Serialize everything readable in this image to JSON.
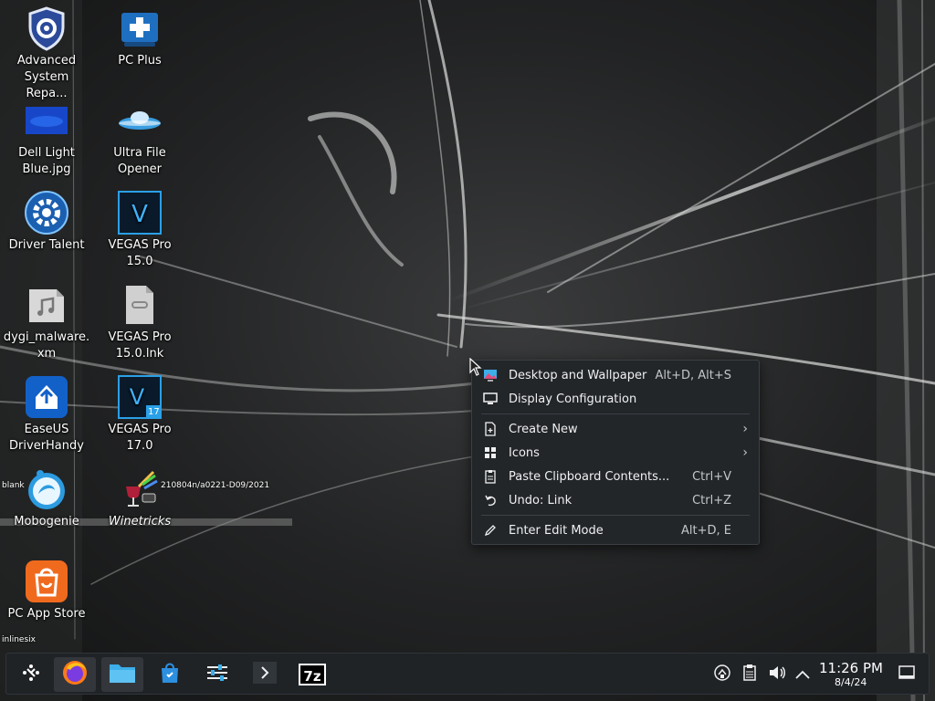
{
  "desktop": {
    "icons": [
      {
        "label": "Advanced System Repa...",
        "icon": "shield-gear-icon"
      },
      {
        "label": "PC Plus",
        "icon": "pc-plus-icon"
      },
      {
        "label": "Dell Light Blue.jpg",
        "icon": "image-file-icon"
      },
      {
        "label": "Ultra File Opener",
        "icon": "ufo-icon"
      },
      {
        "label": "Driver Talent",
        "icon": "gear-icon"
      },
      {
        "label": "VEGAS Pro 15.0",
        "icon": "vegas-icon"
      },
      {
        "label": "dygi_malware.xm",
        "icon": "audio-file-icon"
      },
      {
        "label": "VEGAS Pro 15.0.lnk",
        "icon": "link-file-icon"
      },
      {
        "label": "EaseUS DriverHandy",
        "icon": "easeus-icon"
      },
      {
        "label": "VEGAS Pro 17.0",
        "icon": "vegas17-icon"
      },
      {
        "label": "Mobogenie",
        "icon": "mobogenie-icon"
      },
      {
        "label": "Winetricks",
        "icon": "winetricks-icon"
      },
      {
        "label": "PC App Store",
        "icon": "shopping-bag-icon"
      }
    ],
    "stray_text": {
      "blank": "blank",
      "winetricks_path": "210804n/a0221-D09/2021",
      "inlinesix": "inlinesix",
      "vegas17_badge": "17"
    }
  },
  "context_menu": {
    "items": [
      {
        "label": "Desktop and Wallpaper",
        "shortcut": "Alt+D, Alt+S",
        "icon": "wallpaper-icon"
      },
      {
        "label": "Display Configuration",
        "shortcut": "",
        "icon": "display-icon"
      },
      {
        "label": "Create New",
        "shortcut": "",
        "icon": "new-document-icon",
        "arrow": "›"
      },
      {
        "label": "Icons",
        "shortcut": "",
        "icon": "grid-icon",
        "arrow": "›"
      },
      {
        "label": "Paste Clipboard Contents...",
        "shortcut": "Ctrl+V",
        "icon": "clipboard-icon"
      },
      {
        "label": "Undo: Link",
        "shortcut": "Ctrl+Z",
        "icon": "undo-icon"
      },
      {
        "label": "Enter Edit Mode",
        "shortcut": "Alt+D, E",
        "icon": "pencil-icon"
      }
    ]
  },
  "taskbar": {
    "launchers": [
      {
        "name": "application-launcher",
        "icon": "launcher-icon"
      },
      {
        "name": "firefox",
        "icon": "firefox-icon"
      },
      {
        "name": "file-manager",
        "icon": "folder-icon"
      },
      {
        "name": "discover",
        "icon": "store-bag-icon"
      },
      {
        "name": "system-settings",
        "icon": "sliders-icon"
      },
      {
        "name": "terminal",
        "icon": "chevron-right-icon"
      },
      {
        "name": "7zip",
        "label": "7z",
        "icon": "7zip-icon"
      }
    ],
    "tray": [
      "network-icon",
      "clipboard-icon",
      "volume-icon",
      "chevron-up-icon"
    ],
    "clock": {
      "time": "11:26 PM",
      "date": "8/4/24"
    },
    "show_desktop_icon": "show-desktop-icon"
  },
  "colors": {
    "menu_bg": "#232629",
    "taskbar_bg": "#202326",
    "text": "#eff0f1",
    "accent_blue": "#3daee9"
  }
}
